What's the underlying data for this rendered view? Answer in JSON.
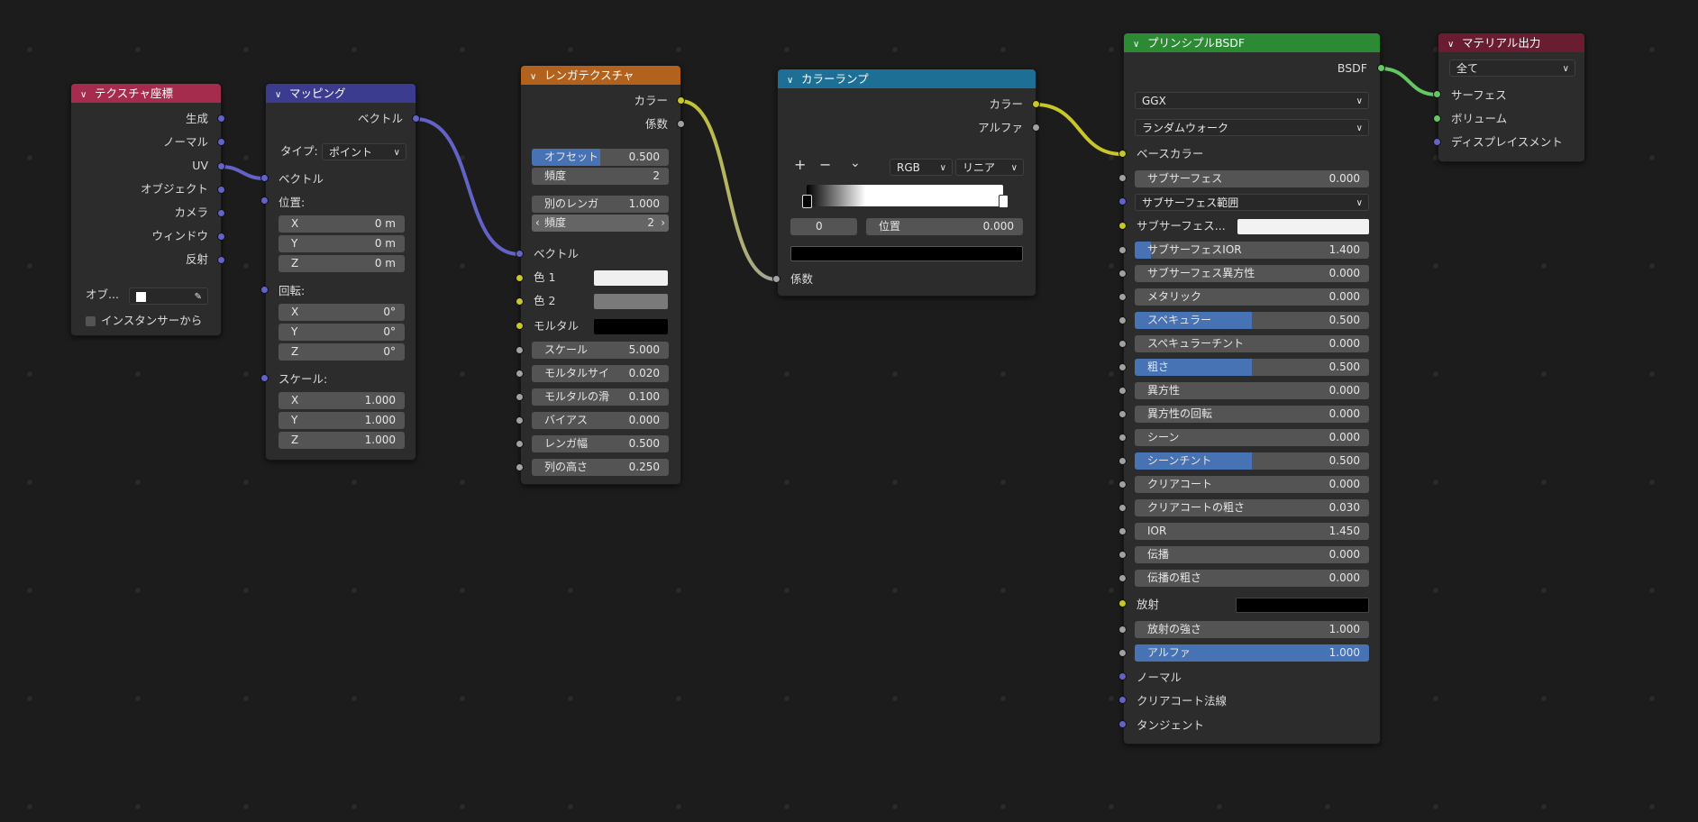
{
  "colors": {
    "texcoord_header": "#a52c4c",
    "mapping_header": "#3b3b8f",
    "brick_header": "#b3621d",
    "ramp_header": "#1e6f95",
    "bsdf_header": "#2b8a33",
    "output_header": "#6a1d30",
    "wire_vector": "#6363c7",
    "wire_color": "#c7c729",
    "wire_shader": "#63c763",
    "field_active": "#4772b3"
  },
  "texcoord": {
    "title": "テクスチャ座標",
    "outputs": [
      "生成",
      "ノーマル",
      "UV",
      "オブジェクト",
      "カメラ",
      "ウィンドウ",
      "反射"
    ],
    "object_label": "オブ...",
    "instancer_label": "インスタンサーから"
  },
  "mapping": {
    "title": "マッピング",
    "output_vector": "ベクトル",
    "type_label": "タイプ:",
    "type_value": "ポイント",
    "input_vector": "ベクトル",
    "location_label": "位置:",
    "location": [
      {
        "axis": "X",
        "value": "0 m"
      },
      {
        "axis": "Y",
        "value": "0 m"
      },
      {
        "axis": "Z",
        "value": "0 m"
      }
    ],
    "rotation_label": "回転:",
    "rotation": [
      {
        "axis": "X",
        "value": "0°"
      },
      {
        "axis": "Y",
        "value": "0°"
      },
      {
        "axis": "Z",
        "value": "0°"
      }
    ],
    "scale_label": "スケール:",
    "scale": [
      {
        "axis": "X",
        "value": "1.000"
      },
      {
        "axis": "Y",
        "value": "1.000"
      },
      {
        "axis": "Z",
        "value": "1.000"
      }
    ]
  },
  "brick": {
    "title": "レンガテクスチャ",
    "out_color": "カラー",
    "out_fac": "係数",
    "offset_label": "オフセット",
    "offset_value": "0.500",
    "offset_fill": 0.5,
    "freq_label": "頻度",
    "freq_value": "2",
    "squash_label": "別のレンガ",
    "squash_value": "1.000",
    "freq2_label": "頻度",
    "freq2_value": "2",
    "in_vector": "ベクトル",
    "color1_label": "色 1",
    "color2_label": "色 2",
    "mortar_label": "モルタル",
    "color1": "#f0f0f0",
    "color2": "#7a7a7a",
    "mortar": "#000000",
    "params": [
      {
        "label": "スケール",
        "value": "5.000"
      },
      {
        "label": "モルタルサイ",
        "value": "0.020"
      },
      {
        "label": "モルタルの滑",
        "value": "0.100"
      },
      {
        "label": "バイアス",
        "value": "0.000"
      },
      {
        "label": "レンガ幅",
        "value": "0.500"
      },
      {
        "label": "列の高さ",
        "value": "0.250"
      }
    ]
  },
  "ramp": {
    "title": "カラーランプ",
    "out_color": "カラー",
    "out_alpha": "アルファ",
    "add": "+",
    "remove": "−",
    "menu": "⌄",
    "mode": "RGB",
    "interp": "リニア",
    "index": "0",
    "pos_label": "位置",
    "pos_value": "0.000",
    "in_fac": "係数"
  },
  "bsdf": {
    "title": "プリンシプルBSDF",
    "out_bsdf": "BSDF",
    "distribution": "GGX",
    "subsurface_method": "ランダムウォーク",
    "base_color": "ベースカラー",
    "ss_radius": "サブサーフェス範囲",
    "ss_color_label": "サブサーフェス...",
    "emission_label": "放射",
    "ss_color": "#f2f2f2",
    "emission_color": "#000000",
    "p1": [
      {
        "label": "サブサーフェス",
        "value": "0.000",
        "fill": 0
      }
    ],
    "p2": [
      {
        "label": "サブサーフェスIOR",
        "value": "1.400",
        "fill": 0.07
      },
      {
        "label": "サブサーフェス異方性",
        "value": "0.000",
        "fill": 0
      },
      {
        "label": "メタリック",
        "value": "0.000",
        "fill": 0
      },
      {
        "label": "スペキュラー",
        "value": "0.500",
        "fill": 0.5
      },
      {
        "label": "スペキュラーチント",
        "value": "0.000",
        "fill": 0
      },
      {
        "label": "粗さ",
        "value": "0.500",
        "fill": 0.5
      },
      {
        "label": "異方性",
        "value": "0.000",
        "fill": 0
      },
      {
        "label": "異方性の回転",
        "value": "0.000",
        "fill": 0
      },
      {
        "label": "シーン",
        "value": "0.000",
        "fill": 0
      },
      {
        "label": "シーンチント",
        "value": "0.500",
        "fill": 0.5
      },
      {
        "label": "クリアコート",
        "value": "0.000",
        "fill": 0
      },
      {
        "label": "クリアコートの粗さ",
        "value": "0.030",
        "fill": 0
      },
      {
        "label": "IOR",
        "value": "1.450",
        "fill": 0
      },
      {
        "label": "伝播",
        "value": "0.000",
        "fill": 0
      },
      {
        "label": "伝播の粗さ",
        "value": "0.000",
        "fill": 0
      }
    ],
    "p3": [
      {
        "label": "放射の強さ",
        "value": "1.000",
        "fill": 0
      },
      {
        "label": "アルファ",
        "value": "1.000",
        "fill": 1
      }
    ],
    "vec_inputs": [
      "ノーマル",
      "クリアコート法線",
      "タンジェント"
    ]
  },
  "output": {
    "title": "マテリアル出力",
    "target": "全て",
    "inputs": [
      "サーフェス",
      "ボリューム",
      "ディスプレイスメント"
    ]
  }
}
